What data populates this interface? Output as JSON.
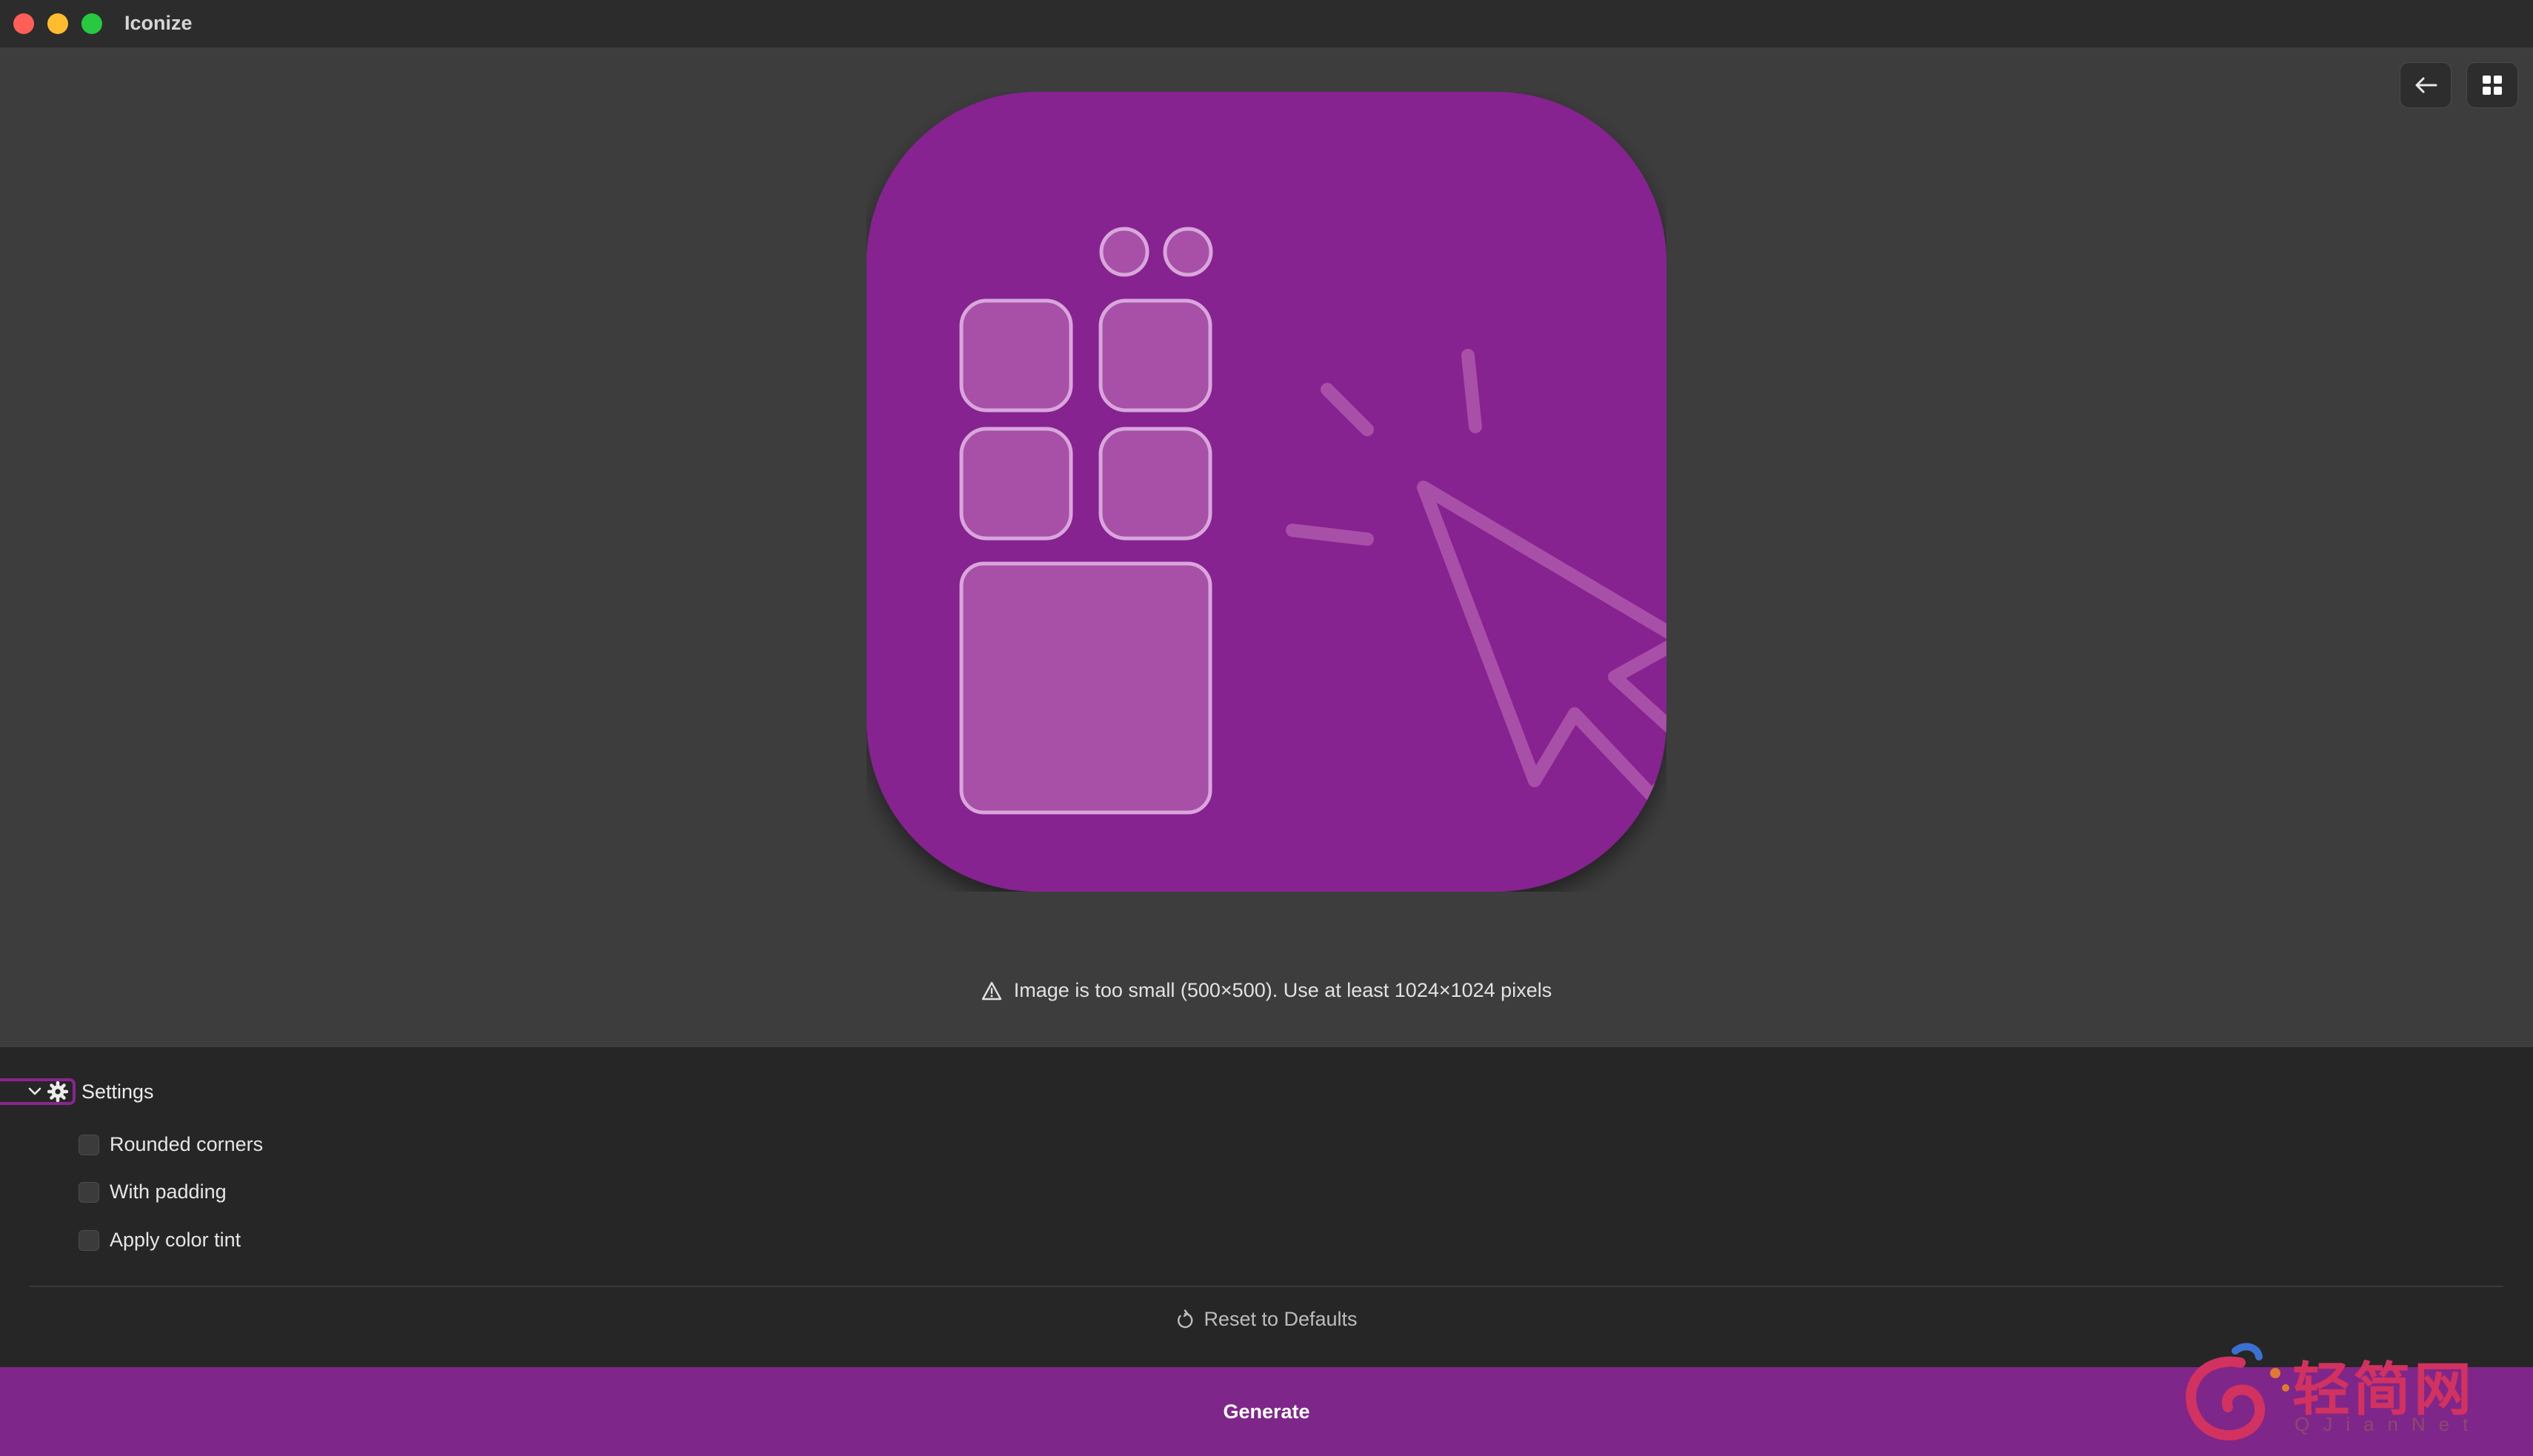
{
  "window": {
    "title": "Iconize"
  },
  "toolbar": {
    "back_icon": "arrow-left-icon",
    "grid_icon": "grid-icon"
  },
  "preview": {
    "icon_colors": {
      "background": "#872491",
      "tile_fill": "#a84fa8",
      "tile_stroke": "#d9a6dc"
    },
    "warning_icon": "warning-triangle-icon",
    "warning_text": "Image is too small (500×500). Use at least 1024×1024 pixels"
  },
  "settings": {
    "title": "Settings",
    "expanded": true,
    "options": [
      {
        "label": "Rounded corners",
        "checked": false
      },
      {
        "label": "With padding",
        "checked": false
      },
      {
        "label": "Apply color tint",
        "checked": false
      }
    ],
    "reset_label": "Reset to Defaults"
  },
  "generate": {
    "label": "Generate"
  },
  "colors": {
    "accent": "#7f268a",
    "preview_bg": "#3d3d3d",
    "panel_bg": "#262626"
  },
  "watermark": {
    "text_cn": "轻简网",
    "text_en": "QJianNet"
  }
}
